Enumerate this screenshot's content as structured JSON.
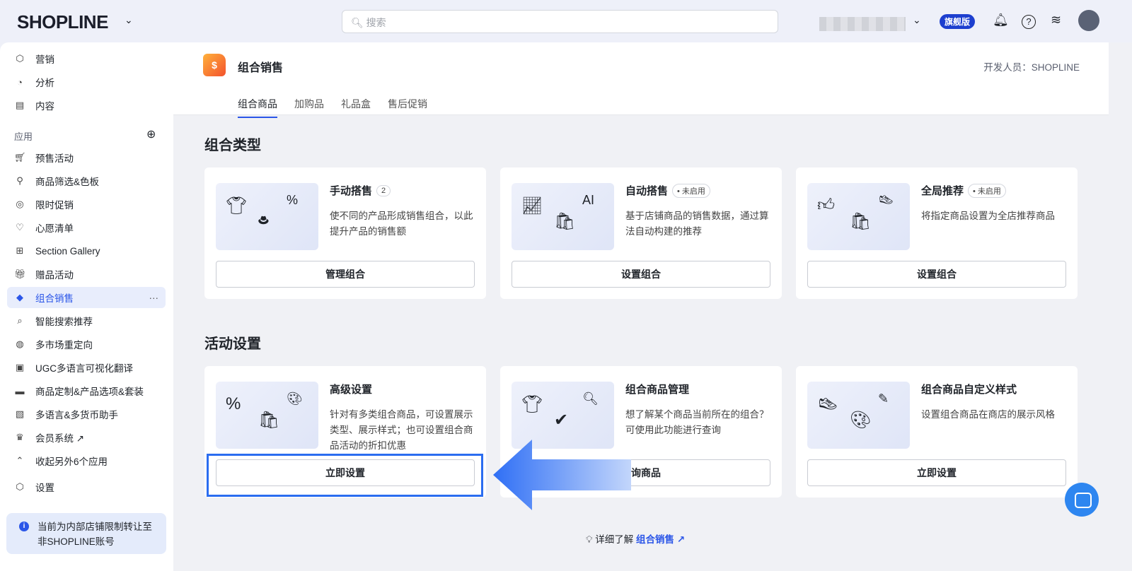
{
  "topbar": {
    "logo": "SHOPLINE",
    "search_placeholder": "搜索",
    "plan_badge": "旗舰版"
  },
  "sidebar": {
    "top_items": [
      {
        "label": "营销",
        "icon": "cube-icon"
      },
      {
        "label": "分析",
        "icon": "pie-chart-icon"
      },
      {
        "label": "内容",
        "icon": "document-icon"
      }
    ],
    "section_label": "应用",
    "apps": [
      {
        "label": "预售活动"
      },
      {
        "label": "商品筛选&色板"
      },
      {
        "label": "限时促销"
      },
      {
        "label": "心愿清单"
      },
      {
        "label": "Section Gallery"
      },
      {
        "label": "赠品活动"
      },
      {
        "label": "组合销售",
        "active": true
      },
      {
        "label": "智能搜索推荐"
      },
      {
        "label": "多市场重定向"
      },
      {
        "label": "UGC多语言可视化翻译"
      },
      {
        "label": "商品定制&产品选项&套装"
      },
      {
        "label": "多语言&多货币助手"
      },
      {
        "label": "会员系统 ↗"
      },
      {
        "label": "收起另外6个应用"
      }
    ],
    "settings": "设置",
    "notice": "当前为内部店铺限制转让至非SHOPLINE账号"
  },
  "page": {
    "title": "组合销售",
    "developer": "开发人员：SHOPLINE",
    "tabs": [
      "组合商品",
      "加购品",
      "礼品盒",
      "售后促销"
    ]
  },
  "section1": {
    "title": "组合类型",
    "cards": [
      {
        "title": "手动搭售",
        "badge": "2",
        "desc": "使不同的产品形成销售组合，以此提升产品的销售额",
        "button": "管理组合"
      },
      {
        "title": "自动搭售",
        "badge": "• 未启用",
        "desc": "基于店铺商品的销售数据，通过算法自动构建的推荐",
        "button": "设置组合"
      },
      {
        "title": "全局推荐",
        "badge": "• 未启用",
        "desc": "将指定商品设置为全店推荐商品",
        "button": "设置组合"
      }
    ]
  },
  "section2": {
    "title": "活动设置",
    "cards": [
      {
        "title": "高级设置",
        "desc": "针对有多类组合商品，可设置展示类型、展示样式；也可设置组合商品活动的折扣优惠",
        "button": "立即设置"
      },
      {
        "title": "组合商品管理",
        "desc": "想了解某个商品当前所在的组合？可使用此功能进行查询",
        "button": "查询商品"
      },
      {
        "title": "组合商品自定义样式",
        "desc": "设置组合商品在商店的展示风格",
        "button": "立即设置"
      }
    ]
  },
  "footer": {
    "learn_prefix": "详细了解",
    "learn_link": "组合销售 ↗"
  }
}
